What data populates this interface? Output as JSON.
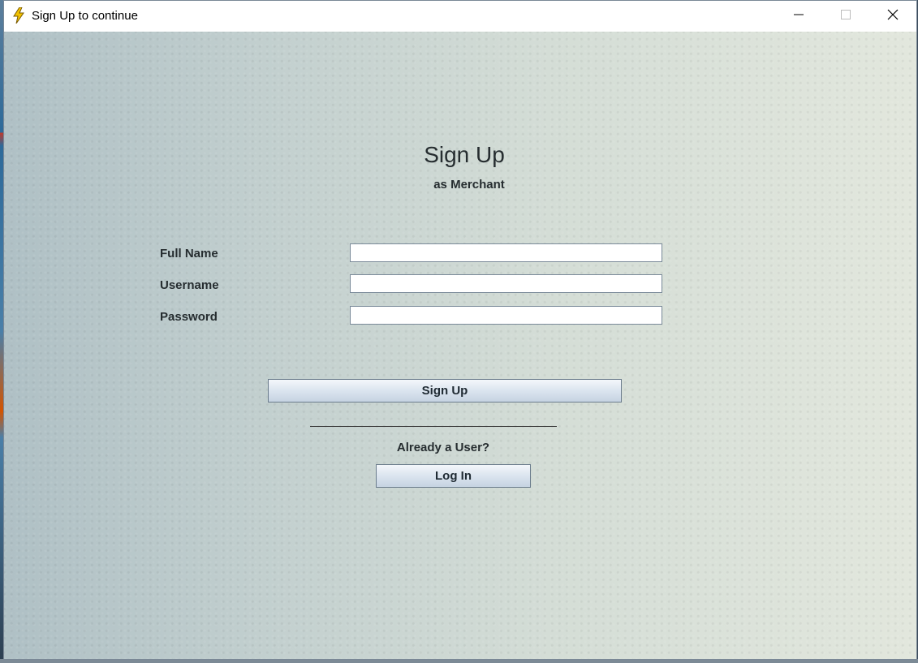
{
  "window": {
    "title": "Sign Up to continue"
  },
  "form": {
    "heading": "Sign Up",
    "subheading": "as Merchant",
    "fields": [
      {
        "label": "Full Name",
        "value": ""
      },
      {
        "label": "Username",
        "value": ""
      },
      {
        "label": "Password",
        "value": ""
      }
    ],
    "signup_button": "Sign Up",
    "already_user_text": "Already a User?",
    "login_button": "Log In"
  },
  "icons": {
    "app": "lightning-bolt-icon",
    "minimize": "minimize-icon",
    "maximize": "maximize-icon",
    "close": "close-icon"
  },
  "colors": {
    "accent_icon": "#f2c200",
    "text": "#262d30"
  }
}
